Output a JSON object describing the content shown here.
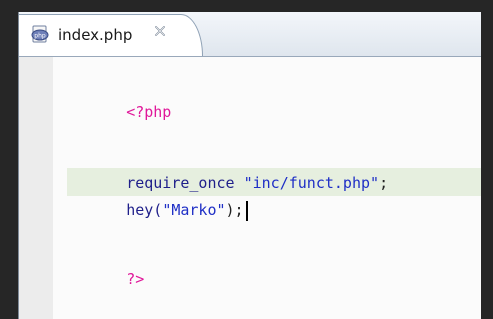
{
  "tab": {
    "filename": "index.php",
    "icon": "php-file-icon",
    "close_icon": "close-icon"
  },
  "code": {
    "line1": "<?php",
    "line3_fn": "require_once",
    "line3_str": "\"inc/funct.php\"",
    "line3_end": ";",
    "line4_fn": "hey(",
    "line4_str": "\"Marko\"",
    "line4_end": ");",
    "line6": "?>"
  },
  "colors": {
    "php_tag": "#e0189a",
    "string": "#1f2fc6",
    "current_line": "#e6efdf"
  }
}
